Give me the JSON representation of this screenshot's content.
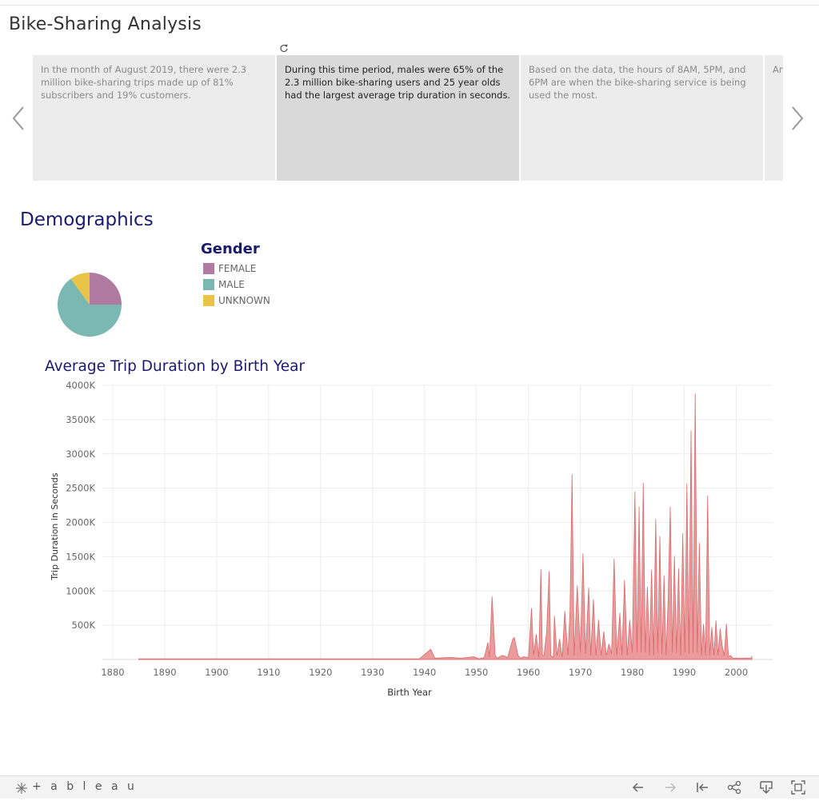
{
  "story": {
    "title": "Bike-Sharing Analysis",
    "points": [
      {
        "text": "In the month of August 2019, there were 2.3 million bike-sharing trips made up of 81% subscribers and 19% customers.",
        "active": false
      },
      {
        "text": "During this time period, males were 65% of the 2.3 million bike-sharing users and 25 year olds had the largest average trip duration in seconds.",
        "active": true
      },
      {
        "text": "Based on the data, the hours of 8AM, 5PM, and 6PM are when the bike-sharing service is being used the most.",
        "active": false
      },
      {
        "text": "An an ma",
        "active": false
      }
    ]
  },
  "demographics": {
    "title": "Demographics",
    "legend_title": "Gender",
    "legend": [
      {
        "label": "FEMALE",
        "color": "#b07aa1"
      },
      {
        "label": "MALE",
        "color": "#7ab8b1"
      },
      {
        "label": "UNKNOWN",
        "color": "#e8c547"
      }
    ]
  },
  "chart_title": "Average Trip Duration by Birth Year",
  "chart_data": [
    {
      "type": "pie",
      "categories": [
        "FEMALE",
        "MALE",
        "UNKNOWN"
      ],
      "values": [
        25,
        65,
        10
      ],
      "colors": [
        "#b07aa1",
        "#7ab8b1",
        "#e8c547"
      ]
    },
    {
      "type": "area",
      "title": "Average Trip Duration by Birth Year",
      "xlabel": "Birth Year",
      "ylabel": "Trip Duration in Seconds",
      "xlim": [
        1878,
        2007
      ],
      "ylim": [
        0,
        4000000
      ],
      "x_ticks": [
        1880,
        1890,
        1900,
        1910,
        1920,
        1930,
        1940,
        1950,
        1960,
        1970,
        1980,
        1990,
        2000
      ],
      "y_ticks": [
        {
          "v": 500000,
          "label": "500K"
        },
        {
          "v": 1000000,
          "label": "1000K"
        },
        {
          "v": 1500000,
          "label": "1500K"
        },
        {
          "v": 2000000,
          "label": "2000K"
        },
        {
          "v": 2500000,
          "label": "2500K"
        },
        {
          "v": 3000000,
          "label": "3000K"
        },
        {
          "v": 3500000,
          "label": "3500K"
        },
        {
          "v": 4000000,
          "label": "4000K"
        }
      ],
      "color": "#e8898a",
      "grid": true,
      "series": [
        {
          "x": [
            1885,
            1900,
            1939,
            1941.2,
            1942,
            1945,
            1947,
            1949.5,
            1950.5,
            1951.5,
            1952.2,
            1952.5,
            1953,
            1953.6,
            1954,
            1955,
            1956,
            1957,
            1957.3,
            1958,
            1958.5,
            1959,
            1960,
            1960.6,
            1961,
            1961.5,
            1962,
            1962.4,
            1962.7,
            1963,
            1963.5,
            1964,
            1964.3,
            1964.8,
            1965,
            1965.5,
            1966,
            1966.5,
            1967,
            1967.6,
            1968,
            1968.4,
            1968.8,
            1969.4,
            1970,
            1970.5,
            1971,
            1971.6,
            1972,
            1972.5,
            1973,
            1973.5,
            1974,
            1974.5,
            1975,
            1975.5,
            1976,
            1976.5,
            1977,
            1977.6,
            1978,
            1978.5,
            1979,
            1979.5,
            1980,
            1980.5,
            1980.9,
            1981.3,
            1981.7,
            1982.1,
            1982.5,
            1982.9,
            1983.3,
            1983.7,
            1984.1,
            1984.5,
            1984.9,
            1985.3,
            1985.7,
            1986.1,
            1986.5,
            1986.9,
            1987.3,
            1987.7,
            1988.1,
            1988.5,
            1988.9,
            1989.3,
            1989.7,
            1990.1,
            1990.5,
            1990.9,
            1991.3,
            1991.7,
            1992.1,
            1992.5,
            1992.9,
            1993.3,
            1993.7,
            1994.1,
            1994.5,
            1994.9,
            1995.3,
            1995.7,
            1996.1,
            1996.5,
            1996.9,
            1997.3,
            1997.7,
            1998.1,
            1998.5,
            1998.9,
            1999.3,
            1999.7,
            2000.1,
            2000.5,
            2000.9,
            2001.3,
            2001.7,
            2002.1,
            2002.5,
            2002.9,
            2003
          ],
          "y": [
            10000,
            10000,
            10000,
            150000,
            20000,
            30000,
            20000,
            40000,
            10000,
            30000,
            250000,
            30000,
            920000,
            60000,
            20000,
            60000,
            30000,
            300000,
            320000,
            60000,
            20000,
            40000,
            30000,
            750000,
            60000,
            370000,
            30000,
            1320000,
            60000,
            60000,
            400000,
            1290000,
            60000,
            30000,
            640000,
            60000,
            300000,
            30000,
            710000,
            60000,
            690000,
            2700000,
            60000,
            1080000,
            100000,
            1550000,
            80000,
            1050000,
            60000,
            880000,
            60000,
            580000,
            60000,
            410000,
            60000,
            230000,
            80000,
            1470000,
            60000,
            680000,
            60000,
            1160000,
            60000,
            580000,
            100000,
            2450000,
            100000,
            2230000,
            100000,
            2580000,
            100000,
            1060000,
            60000,
            1310000,
            60000,
            2050000,
            100000,
            1800000,
            80000,
            1230000,
            60000,
            900000,
            2230000,
            100000,
            1510000,
            100000,
            1330000,
            60000,
            1840000,
            100000,
            2570000,
            80000,
            3340000,
            100000,
            3880000,
            100000,
            1700000,
            60000,
            520000,
            60000,
            2390000,
            60000,
            470000,
            60000,
            570000,
            60000,
            450000,
            200000,
            60000,
            520000,
            40000,
            60000,
            20000,
            20000,
            20000,
            20000,
            20000,
            20000,
            20000,
            20000,
            20000,
            20000,
            50000
          ]
        }
      ]
    }
  ],
  "footer": {
    "brand": "+ a b l e a u",
    "icons": [
      "undo-icon",
      "redo-icon",
      "revert-icon",
      "share-icon",
      "download-icon",
      "fullscreen-icon"
    ]
  }
}
